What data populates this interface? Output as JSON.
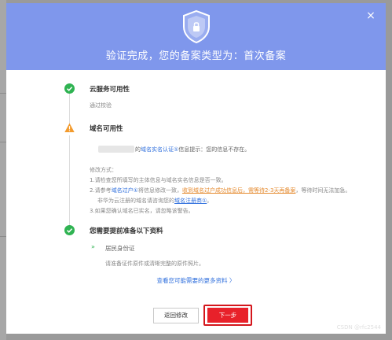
{
  "header": {
    "title": "验证完成，您的备案类型为：首次备案",
    "close_label": "×"
  },
  "step1": {
    "title": "云服务可用性",
    "desc": "通过校验"
  },
  "step2": {
    "title": "域名可用性",
    "line1_prefix": "的",
    "line1_link": "域名实名认证①",
    "line1_suffix": "信息提示：您的信息不存在。",
    "method_label": "修改方式：",
    "m1": "1.请检查您所填写的主体信息与域名实名信息是否一致。",
    "m2_prefix": "2.请参考",
    "m2_link1": "域名过户①",
    "m2_mid": "将信息修改一致，",
    "m2_orange": "收到域名过户成功信息后，需等待2-3天再备案",
    "m2_suffix": "，等待时间无法加急。",
    "m2b_prefix": "非华为云注册的域名请咨询您的",
    "m2b_link": "域名注册商①",
    "m2b_suffix": "。",
    "m3": "3.如果您确认域名已实名，请忽略该警告。"
  },
  "step3": {
    "title": "您需要提前准备以下资料",
    "item_arrow": "»",
    "item_title": "居民身份证",
    "item_desc": "请准备证件原件或清晰完整的原件照片。",
    "more_link": "查看您可能需要的更多资料 〉"
  },
  "buttons": {
    "back": "返回修改",
    "next": "下一步"
  },
  "watermark": "CSDN @rfc2544",
  "colors": {
    "header_bg": "#7f97ec",
    "success": "#2fb352",
    "warning": "#f39b2d",
    "link": "#2f6fdd",
    "next_button": "#e8212a"
  }
}
